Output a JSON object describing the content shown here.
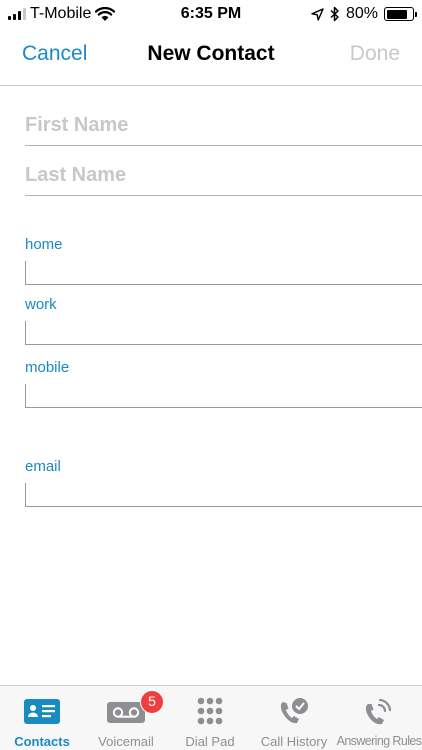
{
  "status_bar": {
    "carrier": "T-Mobile",
    "time": "6:35 PM",
    "battery": "80%",
    "battery_level": 0.8
  },
  "nav": {
    "cancel_label": "Cancel",
    "title": "New Contact",
    "done_label": "Done"
  },
  "form": {
    "first_name_placeholder": "First Name",
    "last_name_placeholder": "Last Name",
    "fields": [
      {
        "label": "home"
      },
      {
        "label": "work"
      },
      {
        "label": "mobile"
      },
      {
        "label": "email"
      }
    ]
  },
  "tabs": [
    {
      "label": "Contacts",
      "icon": "contacts-icon",
      "active": true
    },
    {
      "label": "Voicemail",
      "icon": "voicemail-icon",
      "badge": "5"
    },
    {
      "label": "Dial Pad",
      "icon": "dialpad-icon"
    },
    {
      "label": "Call History",
      "icon": "call-history-icon"
    },
    {
      "label": "Answering Rules",
      "icon": "answering-rules-icon"
    }
  ],
  "colors": {
    "accent": "#1a8ac4",
    "disabled": "#c9c9cc",
    "badge": "#ef3e3e",
    "tab_inactive": "#8e8e93"
  }
}
